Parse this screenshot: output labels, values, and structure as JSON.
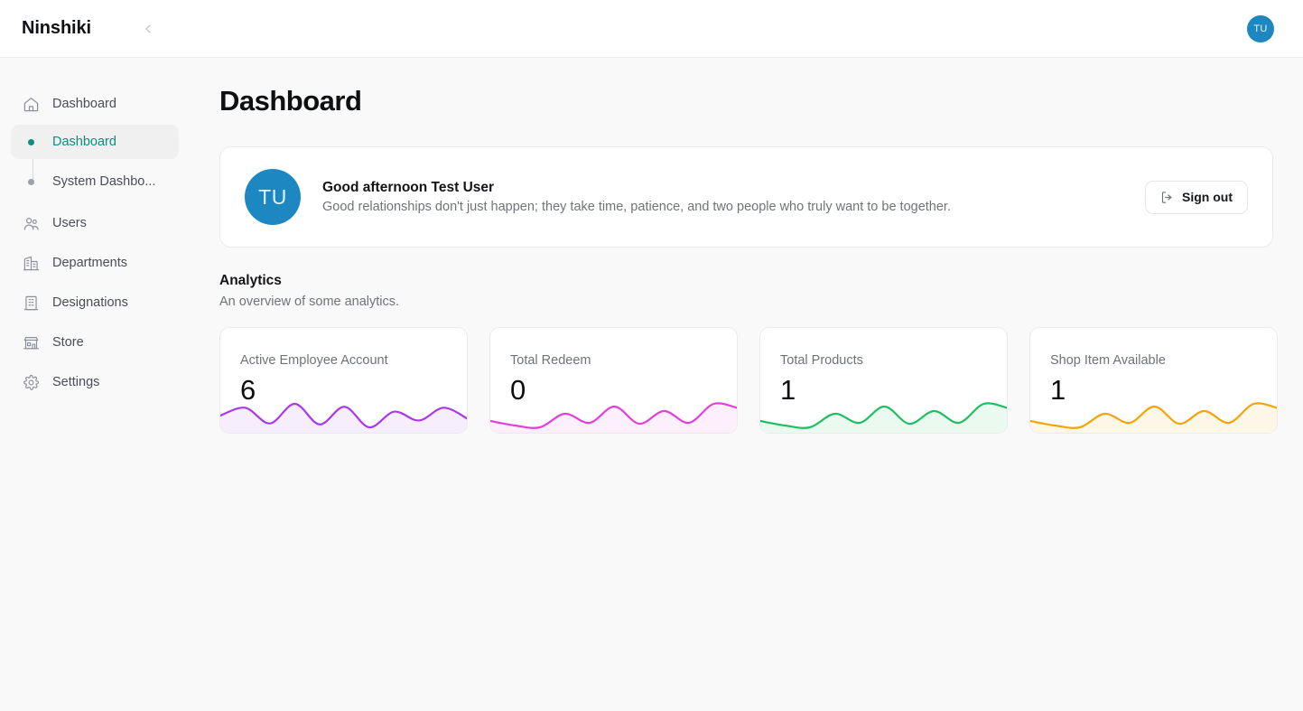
{
  "topbar": {
    "brand": "Ninshiki",
    "collapse_icon": "chevron-left-icon",
    "avatar_initials": "TU"
  },
  "sidebar": {
    "items": [
      {
        "label": "Dashboard",
        "icon": "home-icon",
        "type": "parent"
      },
      {
        "label": "Dashboard",
        "icon": "dot-icon",
        "type": "sub",
        "active": true
      },
      {
        "label": "System Dashbo...",
        "icon": "dot-icon",
        "type": "sub",
        "active": false
      },
      {
        "label": "Users",
        "icon": "users-icon",
        "type": "parent"
      },
      {
        "label": "Departments",
        "icon": "building-icon",
        "type": "parent"
      },
      {
        "label": "Designations",
        "icon": "office-icon",
        "type": "parent"
      },
      {
        "label": "Store",
        "icon": "store-icon",
        "type": "parent"
      },
      {
        "label": "Settings",
        "icon": "gear-icon",
        "type": "parent"
      }
    ],
    "active_color": "#0f8d7f"
  },
  "main": {
    "page_title": "Dashboard",
    "greeting": {
      "avatar_initials": "TU",
      "avatar_color": "#1c87c0",
      "title": "Good afternoon Test User",
      "quote": "Good relationships don't just happen; they take time, patience, and two people who truly want to be together.",
      "signout_label": "Sign out",
      "signout_icon": "logout-icon"
    },
    "analytics": {
      "title": "Analytics",
      "subtitle": "An overview of some analytics.",
      "cards": [
        {
          "label": "Active Employee Account",
          "value": "6",
          "color": "#a939e8",
          "fill": "#f7eefd"
        },
        {
          "label": "Total Redeem",
          "value": "0",
          "color": "#e040d8",
          "fill": "#fdeffc"
        },
        {
          "label": "Total Products",
          "value": "1",
          "color": "#1fbf5f",
          "fill": "#eafaf0"
        },
        {
          "label": "Shop Item Available",
          "value": "1",
          "color": "#f5a405",
          "fill": "#fdf7e8"
        }
      ]
    }
  },
  "chart_data": [
    {
      "type": "area",
      "title": "Active Employee Account",
      "x": [
        0,
        1,
        2,
        3,
        4,
        5,
        6,
        7,
        8,
        9,
        10
      ],
      "values": [
        22,
        30,
        14,
        34,
        13,
        31,
        10,
        26,
        17,
        30,
        18
      ],
      "color": "#a939e8",
      "grid": false,
      "legend": "none"
    },
    {
      "type": "area",
      "title": "Total Redeem",
      "x": [
        0,
        1,
        2,
        3,
        4,
        5,
        6,
        7,
        8,
        9,
        10
      ],
      "values": [
        14,
        9,
        7,
        22,
        12,
        30,
        11,
        25,
        12,
        33,
        28
      ],
      "color": "#e040d8",
      "grid": false,
      "legend": "none"
    },
    {
      "type": "area",
      "title": "Total Products",
      "x": [
        0,
        1,
        2,
        3,
        4,
        5,
        6,
        7,
        8,
        9,
        10
      ],
      "values": [
        14,
        9,
        7,
        22,
        12,
        30,
        11,
        25,
        12,
        33,
        28
      ],
      "color": "#1fbf5f",
      "grid": false,
      "legend": "none"
    },
    {
      "type": "area",
      "title": "Shop Item Available",
      "x": [
        0,
        1,
        2,
        3,
        4,
        5,
        6,
        7,
        8,
        9,
        10
      ],
      "values": [
        14,
        9,
        7,
        22,
        12,
        30,
        11,
        25,
        12,
        33,
        28
      ],
      "color": "#f5a405",
      "grid": false,
      "legend": "none"
    }
  ]
}
